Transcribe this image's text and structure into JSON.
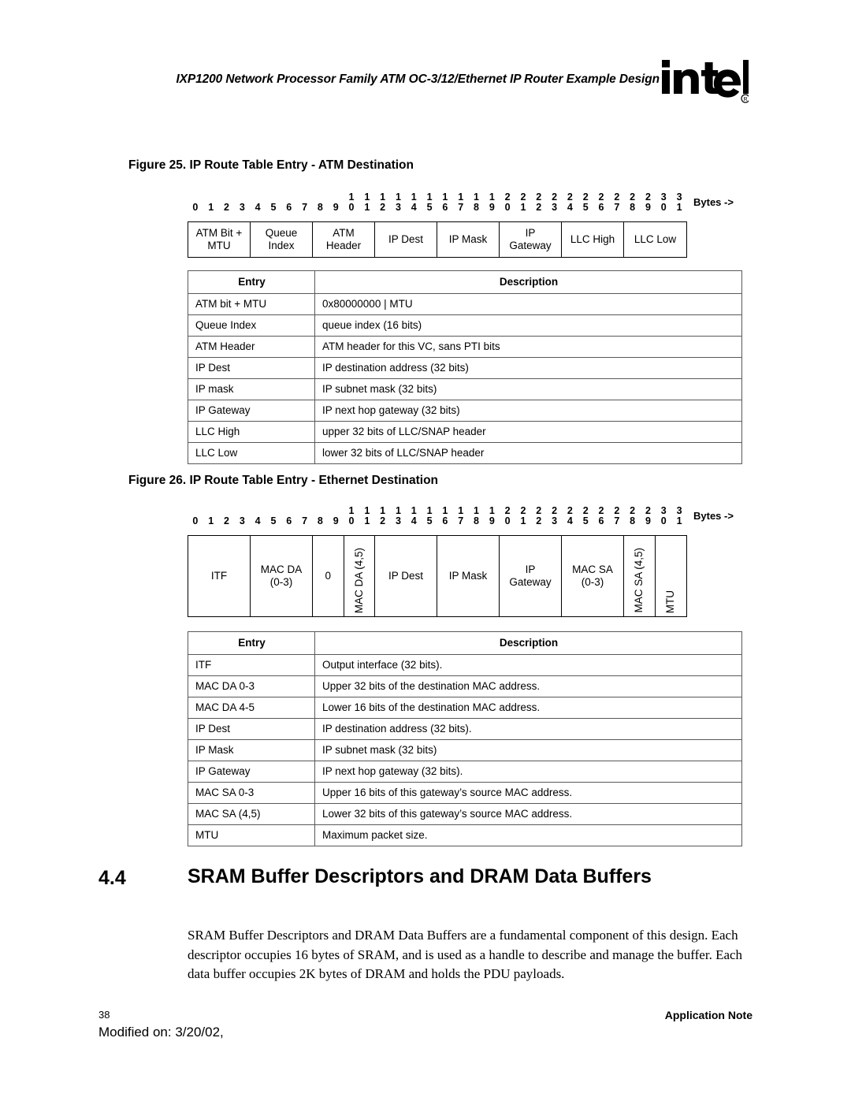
{
  "header": {
    "title": "IXP1200 Network Processor Family ATM OC-3/12/Ethernet IP Router Example Design",
    "logo_text": "intel",
    "logo_registered": "®"
  },
  "bit_ruler": {
    "bits": [
      "0",
      "1",
      "2",
      "3",
      "4",
      "5",
      "6",
      "7",
      "8",
      "9",
      "10",
      "11",
      "12",
      "13",
      "14",
      "15",
      "16",
      "17",
      "18",
      "19",
      "20",
      "21",
      "22",
      "23",
      "24",
      "25",
      "26",
      "27",
      "28",
      "29",
      "30",
      "31"
    ],
    "bytes_label": "Bytes ->"
  },
  "figure25": {
    "caption": "Figure 25. IP Route Table Entry - ATM Destination",
    "fields": [
      {
        "label": "ATM Bit +\nMTU",
        "bytes": 4,
        "vertical": false
      },
      {
        "label": "Queue\nIndex",
        "bytes": 4,
        "vertical": false
      },
      {
        "label": "ATM\nHeader",
        "bytes": 4,
        "vertical": false
      },
      {
        "label": "IP Dest",
        "bytes": 4,
        "vertical": false
      },
      {
        "label": "IP Mask",
        "bytes": 4,
        "vertical": false
      },
      {
        "label": "IP\nGateway",
        "bytes": 4,
        "vertical": false
      },
      {
        "label": "LLC High",
        "bytes": 4,
        "vertical": false
      },
      {
        "label": "LLC Low",
        "bytes": 4,
        "vertical": false
      }
    ],
    "table": {
      "headers": [
        "Entry",
        "Description"
      ],
      "rows": [
        [
          "ATM bit + MTU",
          "0x80000000 | MTU"
        ],
        [
          "Queue Index",
          "queue index (16 bits)"
        ],
        [
          "ATM Header",
          "ATM header for this VC, sans PTI bits"
        ],
        [
          "IP Dest",
          "IP destination address (32 bits)"
        ],
        [
          "IP mask",
          "IP subnet mask (32 bits)"
        ],
        [
          "IP Gateway",
          "IP next hop gateway (32 bits)"
        ],
        [
          "LLC High",
          "upper 32 bits of LLC/SNAP header"
        ],
        [
          "LLC Low",
          "lower 32 bits of LLC/SNAP header"
        ]
      ]
    }
  },
  "figure26": {
    "caption": "Figure 26. IP Route Table Entry - Ethernet Destination",
    "fields": [
      {
        "label": "ITF",
        "bytes": 4,
        "vertical": false
      },
      {
        "label": "MAC DA\n(0-3)",
        "bytes": 4,
        "vertical": false
      },
      {
        "label": "0",
        "bytes": 2,
        "vertical": false
      },
      {
        "label": "MAC DA (4,5)",
        "bytes": 2,
        "vertical": true
      },
      {
        "label": "IP Dest",
        "bytes": 4,
        "vertical": false
      },
      {
        "label": "IP Mask",
        "bytes": 4,
        "vertical": false
      },
      {
        "label": "IP\nGateway",
        "bytes": 4,
        "vertical": false
      },
      {
        "label": "MAC SA\n(0-3)",
        "bytes": 4,
        "vertical": false
      },
      {
        "label": "MAC SA (4,5)",
        "bytes": 2,
        "vertical": true
      },
      {
        "label": "MTU",
        "bytes": 2,
        "vertical": true
      }
    ],
    "table": {
      "headers": [
        "Entry",
        "Description"
      ],
      "rows": [
        [
          "ITF",
          "Output interface (32 bits)."
        ],
        [
          "MAC DA 0-3",
          "Upper 32 bits of the destination MAC address."
        ],
        [
          "MAC DA 4-5",
          "Lower 16 bits of the destination MAC address."
        ],
        [
          "IP Dest",
          "IP destination address (32 bits)."
        ],
        [
          "IP Mask",
          "IP subnet mask (32 bits)"
        ],
        [
          "IP Gateway",
          "IP next hop gateway (32 bits)."
        ],
        [
          "MAC SA 0-3",
          "Upper 16 bits of this gateway’s source MAC address."
        ],
        [
          "MAC SA (4,5)",
          "Lower 32 bits of this gateway’s source MAC address."
        ],
        [
          "MTU",
          "Maximum packet size."
        ]
      ]
    }
  },
  "section": {
    "number": "4.4",
    "title": "SRAM Buffer Descriptors and DRAM Data Buffers",
    "body": "SRAM Buffer Descriptors and DRAM Data Buffers are a fundamental component of this design. Each descriptor occupies 16 bytes of SRAM, and is used as a handle to describe and manage the buffer. Each data buffer occupies 2K bytes of DRAM and holds the PDU payloads."
  },
  "footer": {
    "page_number": "38",
    "modified": "Modified on: 3/20/02,",
    "doc_type": "Application Note"
  },
  "colors": {
    "text": "#000000",
    "table_border": "#58585a",
    "diagram_border": "#000000",
    "page_background": "#ffffff"
  }
}
